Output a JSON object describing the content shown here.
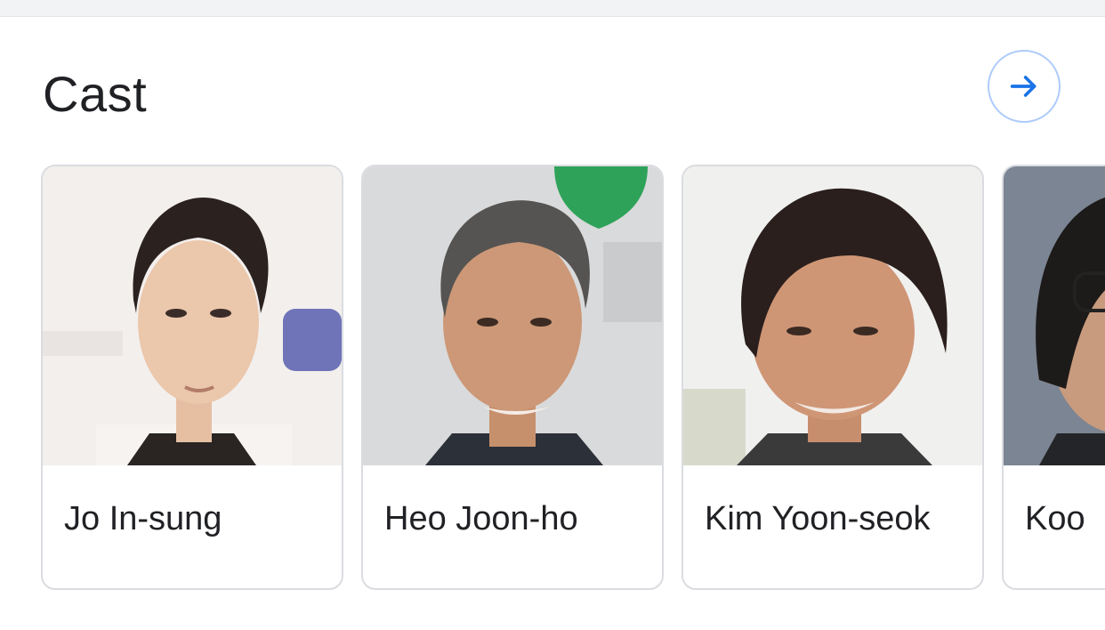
{
  "section": {
    "title": "Cast",
    "more_button_icon": "arrow-right-icon",
    "accent_color": "#1a73e8"
  },
  "cast": [
    {
      "name": "Jo In-sung"
    },
    {
      "name": "Heo Joon-ho"
    },
    {
      "name": "Kim Yoon-seok"
    },
    {
      "name": "Koo"
    }
  ]
}
